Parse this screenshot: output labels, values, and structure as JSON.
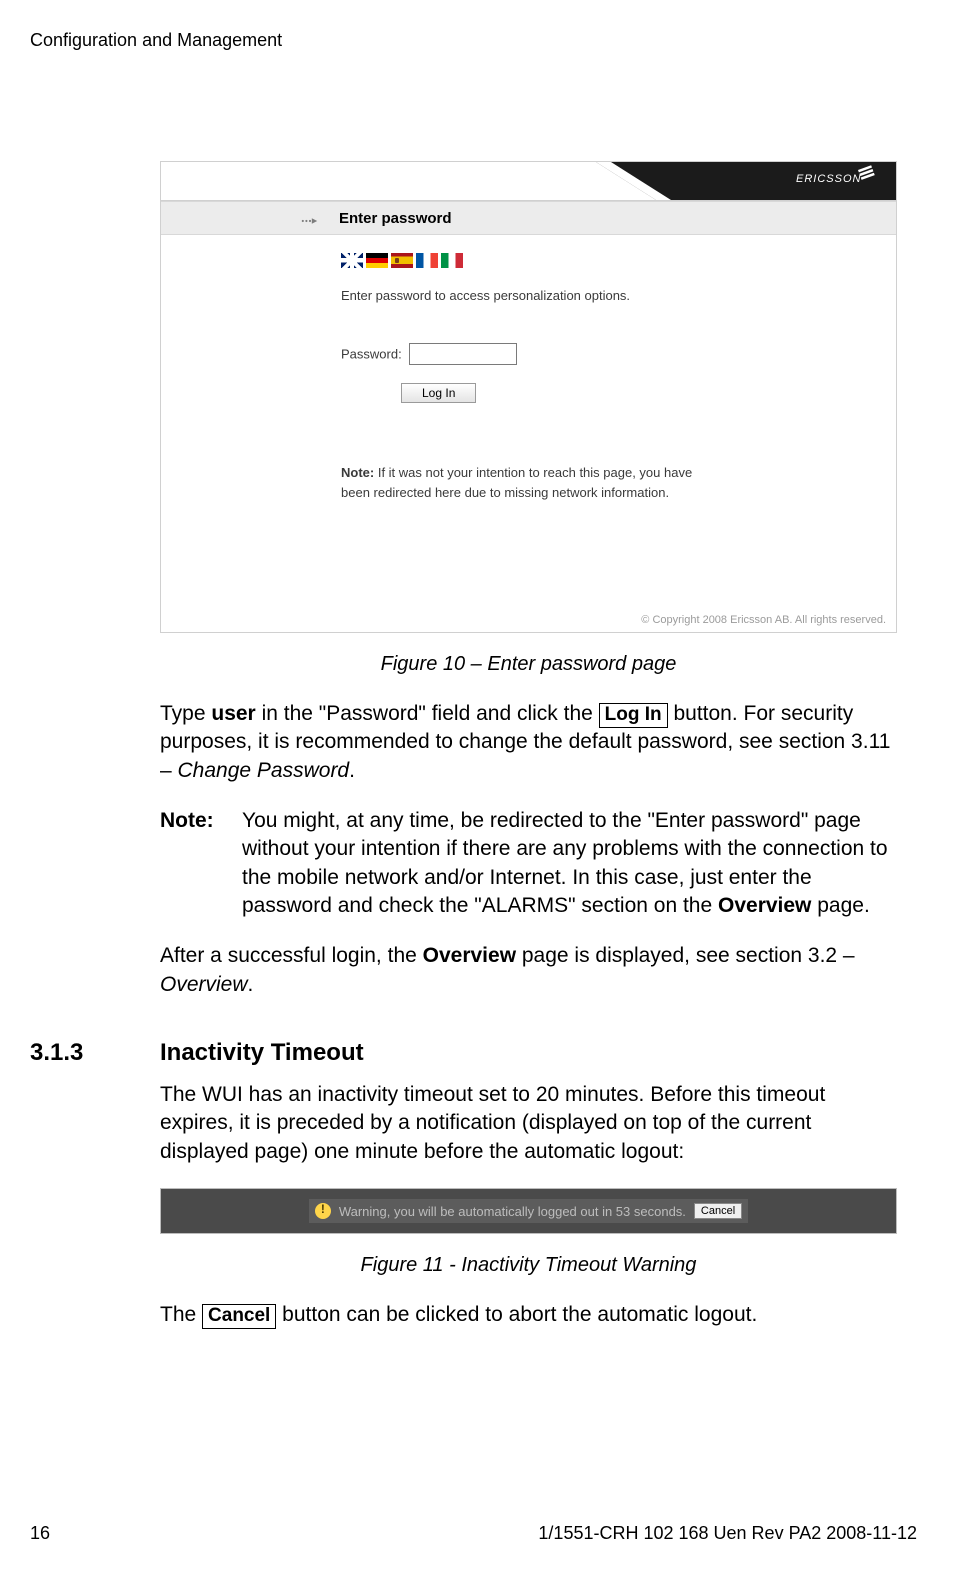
{
  "header": {
    "title": "Configuration and Management"
  },
  "figure10": {
    "brand": "ERICSSON",
    "heading": "Enter password",
    "instruction": "Enter password to access personalization options.",
    "password_label": "Password:",
    "login_button": "Log In",
    "note_label": "Note:",
    "note_text": " If it was not your intention to reach this page, you have been redirected here due to missing network information.",
    "copyright": "© Copyright 2008 Ericsson AB. All rights reserved.",
    "caption": "Figure 10 – Enter password page"
  },
  "para1": {
    "pre": "Type ",
    "user": "user",
    "mid1": " in the \"Password\" field and click the ",
    "button": "Log In",
    "mid2": " button. For security purposes, it is recommended to change the default password, see section 3.11 – ",
    "ital": "Change Password",
    "post": "."
  },
  "note": {
    "label": "Note:",
    "pre": "You might, at any time, be redirected to the \"Enter password\" page without your intention if there are any problems with the connection to the mobile network and/or Internet. In this case, just enter the password and check the \"ALARMS\" section on the ",
    "bold": "Overview",
    "post": " page."
  },
  "para2": {
    "pre": "After a successful login, the ",
    "bold": "Overview",
    "mid": " page is displayed, see section 3.2 – ",
    "ital": "Overview",
    "post": "."
  },
  "section": {
    "num": "3.1.3",
    "title": "Inactivity Timeout"
  },
  "para3": "The WUI has an inactivity timeout set to 20 minutes. Before this timeout expires, it is preceded by a notification (displayed on top of the current displayed page) one minute before the automatic logout:",
  "figure11": {
    "text": "Warning, you will be automatically logged out in 53 seconds.",
    "cancel": "Cancel",
    "caption": "Figure 11 - Inactivity Timeout Warning"
  },
  "para4": {
    "pre": "The ",
    "button": "Cancel",
    "post": " button can be clicked to abort the automatic logout."
  },
  "footer": {
    "page": "16",
    "docref": "1/1551-CRH 102 168 Uen Rev PA2  2008-11-12"
  }
}
